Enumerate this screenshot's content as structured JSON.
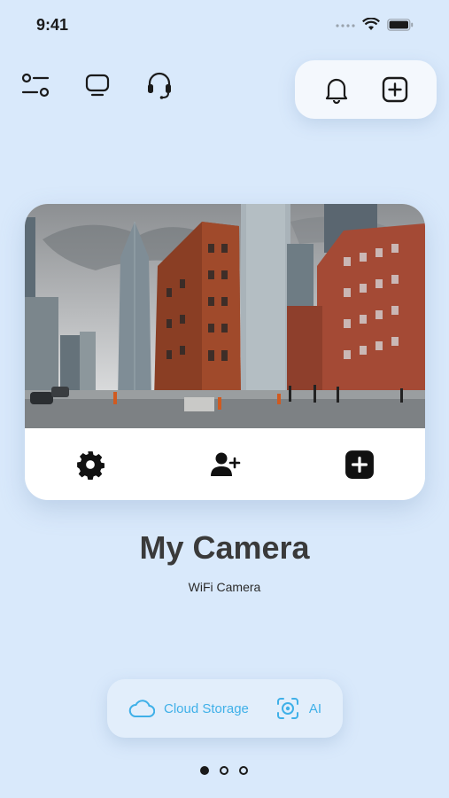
{
  "status_bar": {
    "time": "9:41"
  },
  "top_icons": {
    "left": [
      "filter-settings-icon",
      "tv-icon",
      "headset-icon"
    ],
    "right": [
      "bell-icon",
      "add-square-icon"
    ]
  },
  "camera_card": {
    "preview_image": "city-street-preview",
    "actions": [
      "gear-icon",
      "add-user-icon",
      "add-square-icon"
    ]
  },
  "device": {
    "name": "My Camera",
    "type": "WiFi Camera"
  },
  "features": [
    {
      "label": "Cloud Storage",
      "icon": "cloud-icon"
    },
    {
      "label": "AI",
      "icon": "ai-scan-icon"
    }
  ],
  "pagination": {
    "current": 1,
    "total": 3
  },
  "colors": {
    "background": "#d9e9fb",
    "accent": "#3fb0e8",
    "text": "#3a3a3a"
  }
}
